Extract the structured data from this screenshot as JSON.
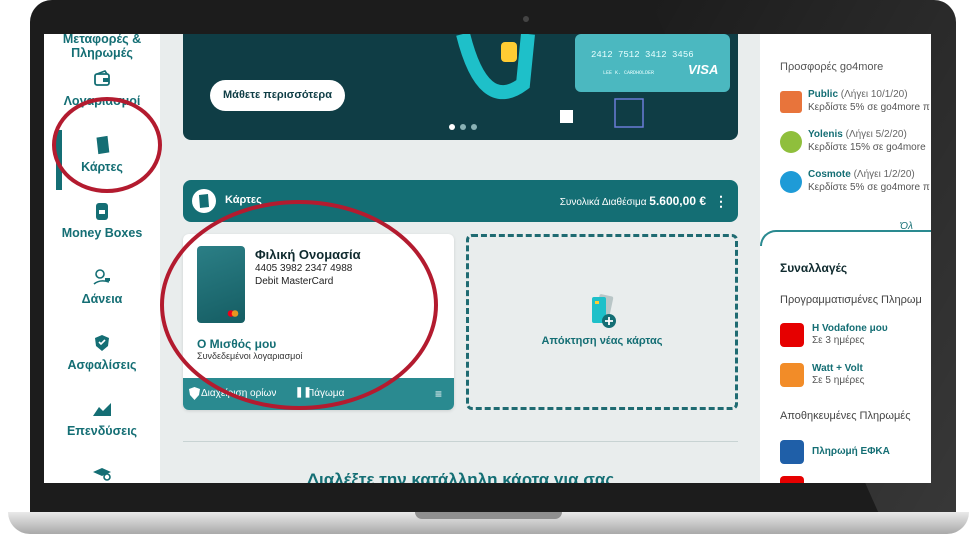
{
  "sidebar": {
    "items": [
      {
        "label": "Μεταφορές & Πληρωμές",
        "icon": "transfer-icon"
      },
      {
        "label": "Λογαριασμοί",
        "icon": "wallet-icon"
      },
      {
        "label": "Κάρτες",
        "icon": "card-icon",
        "active": true
      },
      {
        "label": "Money Boxes",
        "icon": "money-box-icon"
      },
      {
        "label": "Δάνεια",
        "icon": "loan-icon"
      },
      {
        "label": "Ασφαλίσεις",
        "icon": "insurance-icon"
      },
      {
        "label": "Επενδύσεις",
        "icon": "investment-icon"
      }
    ]
  },
  "banner": {
    "button_label": "Μάθετε περισσότερα",
    "card_number": "2412 7512 3412 3456",
    "card_holder": "LEE K. CARDHOLDER",
    "card_brand": "VISA"
  },
  "cards_section": {
    "title": "Κάρτες",
    "available_label": "Συνολικά Διαθέσιμα",
    "available_amount": "5.600,00 €",
    "card": {
      "name": "Φιλική Ονομασία",
      "number": "4405 3982 2347 4988",
      "type": "Debit MasterCard",
      "owner": "Ο Μισθός μου",
      "linked": "Συνδεδεμένοι λογαριασμοί",
      "action_limits": "Διαχείριση ορίων",
      "action_freeze": "Πάγωμα"
    },
    "new_card_label": "Απόκτηση νέας κάρτας"
  },
  "promo_title": "Διαλέξτε την κατάλληλη κάρτα για σας",
  "right_panel": {
    "offers_title": "Προσφορές go4more",
    "offers": [
      {
        "name": "Public",
        "expiry": "(Λήγει 10/1/20)",
        "desc": "Κερδίστε 5% σε go4more π",
        "color": "#e8743b"
      },
      {
        "name": "Yolenis",
        "expiry": "(Λήγει 5/2/20)",
        "desc": "Κερδίστε 15% σε go4more",
        "color": "#8fbf3c"
      },
      {
        "name": "Cosmote",
        "expiry": "(Λήγει 1/2/20)",
        "desc": "Κερδίστε 5% σε go4more π",
        "color": "#1e9bd7"
      }
    ],
    "see_all": "Όλ",
    "transactions_title": "Συναλλαγές",
    "scheduled_title": "Προγραμματισμένες Πληρωμ",
    "scheduled": [
      {
        "name": "Η Vodafone μου",
        "when": "Σε 3 ημέρες",
        "color": "#e60000"
      },
      {
        "name": "Watt + Volt",
        "when": "Σε 5 ημέρες",
        "color": "#f28c28"
      }
    ],
    "saved_title": "Αποθηκευμένες Πληρωμές",
    "saved": [
      {
        "name": "Πληρωμή ΕΦΚΑ",
        "color": "#1f5fa8"
      }
    ]
  }
}
